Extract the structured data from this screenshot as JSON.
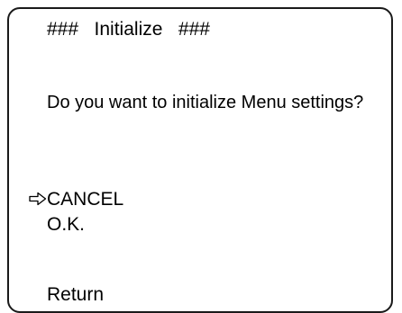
{
  "menu": {
    "title": "###   Initialize   ###",
    "question": "Do you want to initialize Menu settings?",
    "options": [
      {
        "label": "CANCEL",
        "selected": true
      },
      {
        "label": "O.K.",
        "selected": false
      }
    ],
    "cursor_icon": "right-arrow-outline-icon",
    "return_label": "Return"
  }
}
